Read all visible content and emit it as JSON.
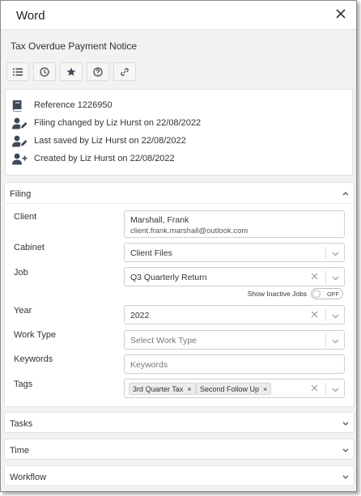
{
  "window": {
    "title": "Word"
  },
  "document": {
    "title": "Tax Overdue Payment Notice"
  },
  "toolbar": {
    "buttons": [
      {
        "icon": "list-icon"
      },
      {
        "icon": "clock-icon"
      },
      {
        "icon": "star-icon"
      },
      {
        "icon": "help-icon"
      },
      {
        "icon": "link-icon"
      }
    ]
  },
  "info": {
    "reference": "Reference 1226950",
    "filing_changed": "Filing changed by Liz Hurst on 22/08/2022",
    "last_saved": "Last saved by Liz Hurst on 22/08/2022",
    "created": "Created by Liz Hurst on 22/08/2022"
  },
  "filing": {
    "header": "Filing",
    "client": {
      "label": "Client",
      "name": "Marshall, Frank",
      "email": "client.frank.marshall@outlook.com"
    },
    "cabinet": {
      "label": "Cabinet",
      "value": "Client Files"
    },
    "job": {
      "label": "Job",
      "value": "Q3 Quarterly Return"
    },
    "inactive_jobs": {
      "label": "Show Inactive Jobs",
      "state": "OFF"
    },
    "year": {
      "label": "Year",
      "value": "2022"
    },
    "work_type": {
      "label": "Work Type",
      "placeholder": "Select Work Type"
    },
    "keywords": {
      "label": "Keywords",
      "placeholder": "Keywords"
    },
    "tags": {
      "label": "Tags",
      "items": [
        "3rd Quarter Tax",
        "Second Follow Up"
      ]
    }
  },
  "sections": {
    "tasks": "Tasks",
    "time": "Time",
    "workflow": "Workflow"
  },
  "colors": {
    "icon": "#3b4a5a",
    "border": "#cfcfcf",
    "panel_bg": "#f2f2f2"
  }
}
